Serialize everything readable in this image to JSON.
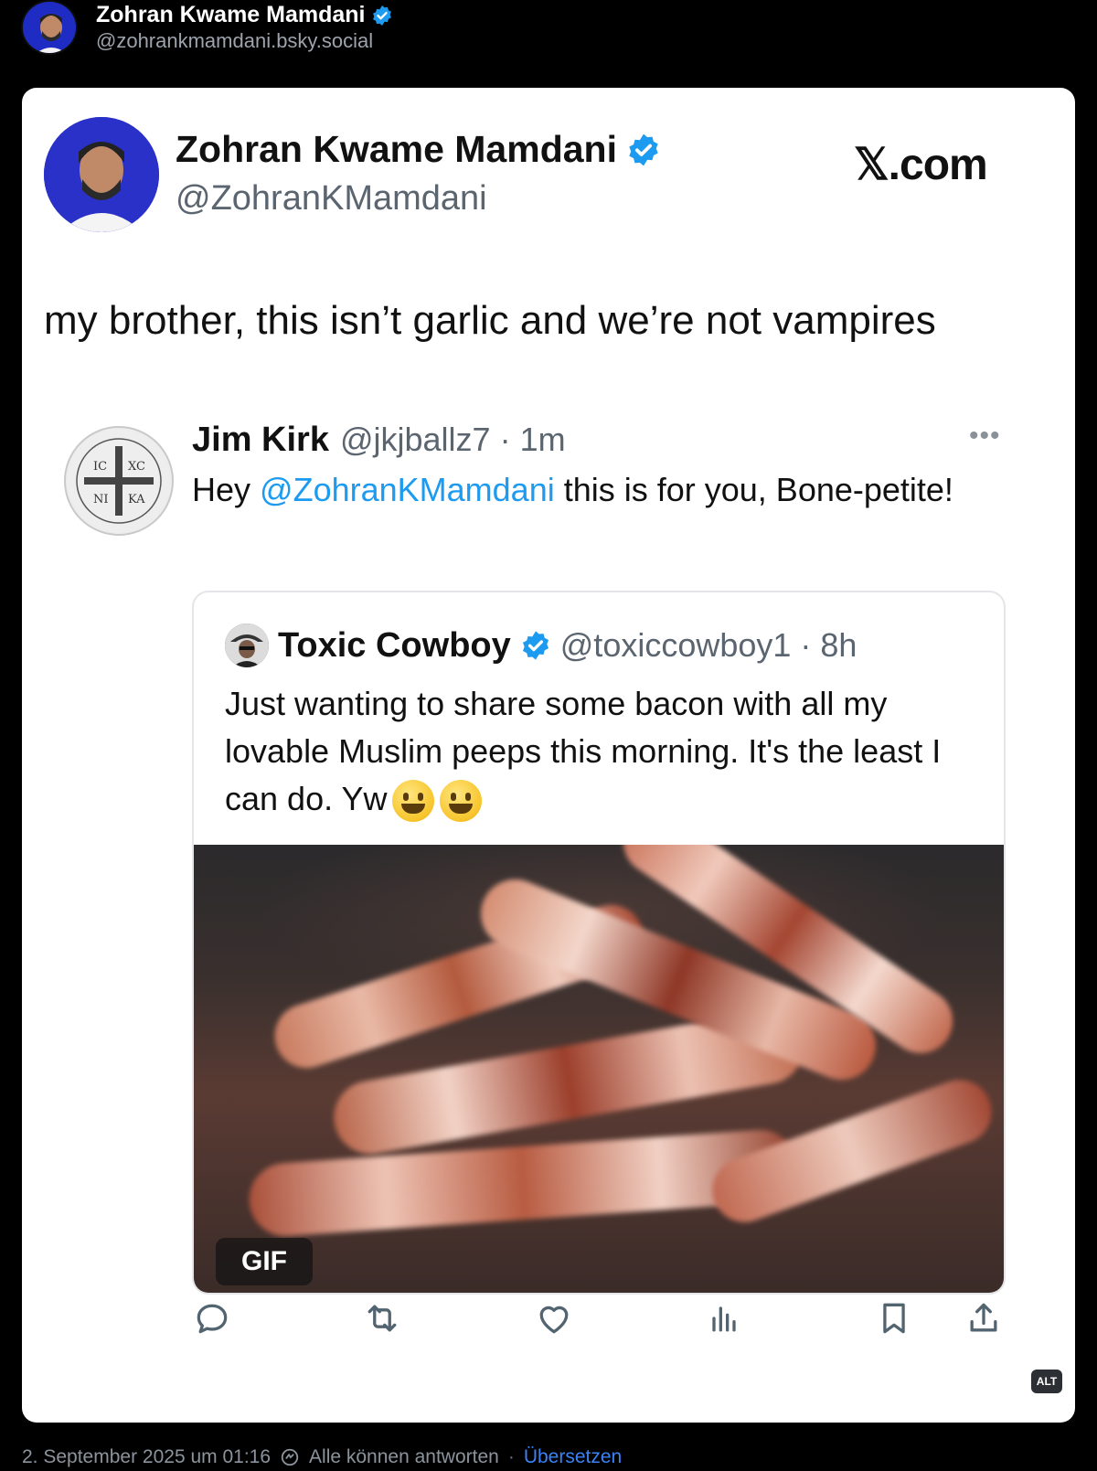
{
  "header": {
    "name": "Zohran Kwame Mamdani",
    "handle": "@zohrankmamdani.bsky.social",
    "verified_color": "#1d9bf0"
  },
  "card": {
    "name": "Zohran Kwame Mamdani",
    "handle": "@ZohranKMamdani",
    "site": "𝕏.com",
    "text": "my brother, this isn’t garlic and we’re not vampires",
    "reply": {
      "name": "Jim Kirk",
      "meta": "@jkjballz7 · 1m",
      "text_before": "Hey ",
      "mention": "@ZohranKMamdani",
      "text_after": " this is for you, Bone-petite!",
      "avatar_letters": [
        "IC",
        "XC",
        "NI",
        "KA"
      ]
    },
    "quote": {
      "name": "Toxic Cowboy",
      "meta": "@toxiccowboy1 · 8h",
      "text": "Just wanting to share some bacon with all my lovable Muslim peeps this morning. It's the least I can do. Yw",
      "media_badge": "GIF"
    },
    "actions": [
      "reply-icon",
      "retweet-icon",
      "like-icon",
      "views-icon",
      "bookmark-icon",
      "share-icon"
    ],
    "alt_badge": "ALT"
  },
  "footer": {
    "date": "2. September 2025 um 01:16",
    "reply_setting": "Alle können antworten",
    "separator": "·",
    "translate": "Übersetzen"
  }
}
